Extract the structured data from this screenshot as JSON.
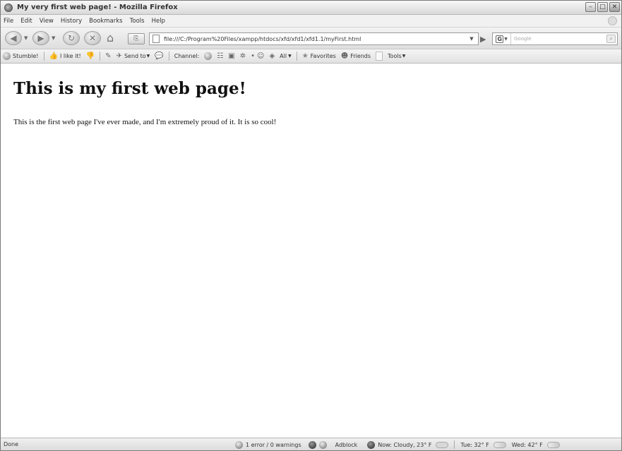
{
  "window": {
    "title": "My very first web page! - Mozilla Firefox",
    "controls": {
      "minimize": "–",
      "maximize": "□",
      "close": "✕"
    }
  },
  "menu": {
    "items": [
      "File",
      "Edit",
      "View",
      "History",
      "Bookmarks",
      "Tools",
      "Help"
    ]
  },
  "nav": {
    "back_glyph": "◀",
    "forward_glyph": "▶",
    "reload_glyph": "↻",
    "stop_glyph": "✕",
    "home_glyph": "⌂",
    "url": "file:///C:/Program%20Files/xampp/htdocs/xfd/xfd1/xfd1.1/myFirst.html",
    "go_glyph": "▶",
    "search_engine_glyph": "G",
    "search_placeholder": "Google"
  },
  "toolbar2": {
    "stumble": "Stumble!",
    "like": "I like it!",
    "send_to": "Send to",
    "channel": "Channel:",
    "all": "All",
    "favorites": "Favorites",
    "friends": "Friends",
    "tools": "Tools"
  },
  "page": {
    "heading": "This is my first web page!",
    "paragraph": "This is the first web page I've ever made, and I'm extremely proud of it. It is so cool!"
  },
  "status": {
    "left": "Done",
    "errors": "1 error / 0 warnings",
    "adblock": "Adblock",
    "weather_now": "Now: Cloudy, 23° F",
    "weather_tue": "Tue: 32° F",
    "weather_wed": "Wed: 42° F"
  }
}
